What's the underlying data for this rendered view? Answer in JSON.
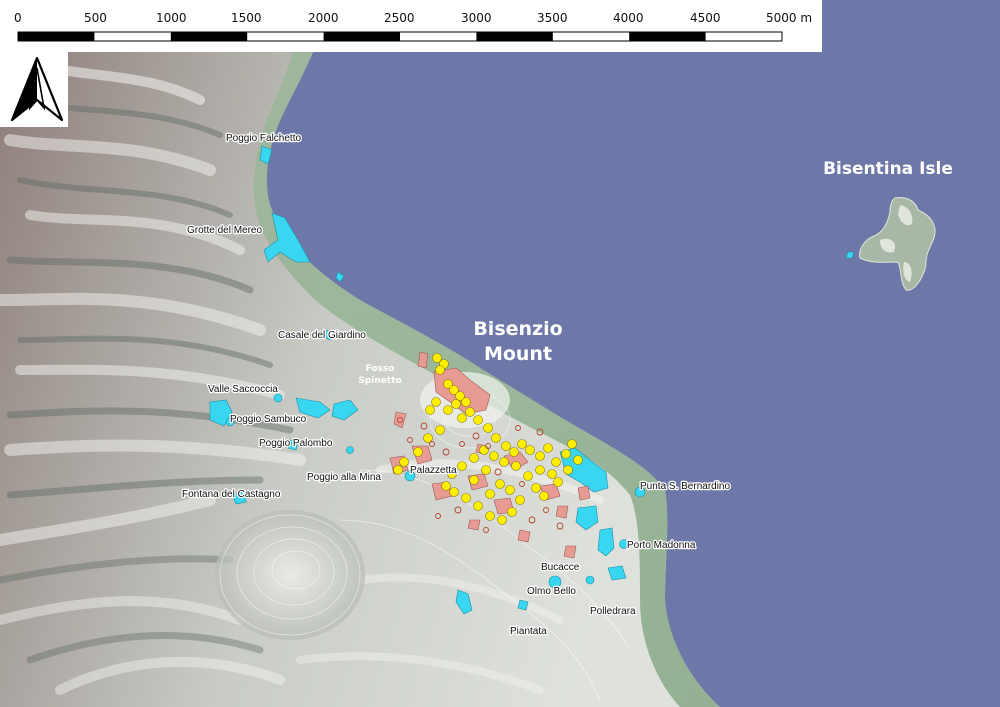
{
  "scale_bar": {
    "ticks": [
      "0",
      "500",
      "1000",
      "1500",
      "2000",
      "2500",
      "3000",
      "3500",
      "4000",
      "4500",
      "5000 m"
    ]
  },
  "north_arrow": {
    "icon": "north-arrow-icon"
  },
  "labels": {
    "bisenzio_mount_line1": "Bisenzio",
    "bisenzio_mount_line2": "Mount",
    "bisentina_isle": "Bisentina Isle",
    "fosso_line1": "Fosso",
    "fosso_line2": "Spinetto"
  },
  "places": [
    "Poggio Falchetto",
    "Grotte del Mereo",
    "Casale del Giardino",
    "Valle Saccoccia",
    "Poggio Sambuco",
    "Poggio Palombo",
    "Poggio alla Mina",
    "Fontana del Castagno",
    "Palazzetta",
    "Punta S. Bernardino",
    "Porto Madonna",
    "Bucacce",
    "Olmo Bello",
    "Polledrara",
    "Piantata"
  ],
  "colors": {
    "lake": "#6e78a8",
    "terrain_light": "#e9ece6",
    "terrain_mid": "#9aa39a",
    "terrain_dark": "#5f6a63",
    "terrain_red": "#b98a86",
    "coast_green": "#8fb08f",
    "cyan_areas": "#38d6f0",
    "pink_areas": "#e89a94",
    "yellow_points": "#ffee00"
  }
}
